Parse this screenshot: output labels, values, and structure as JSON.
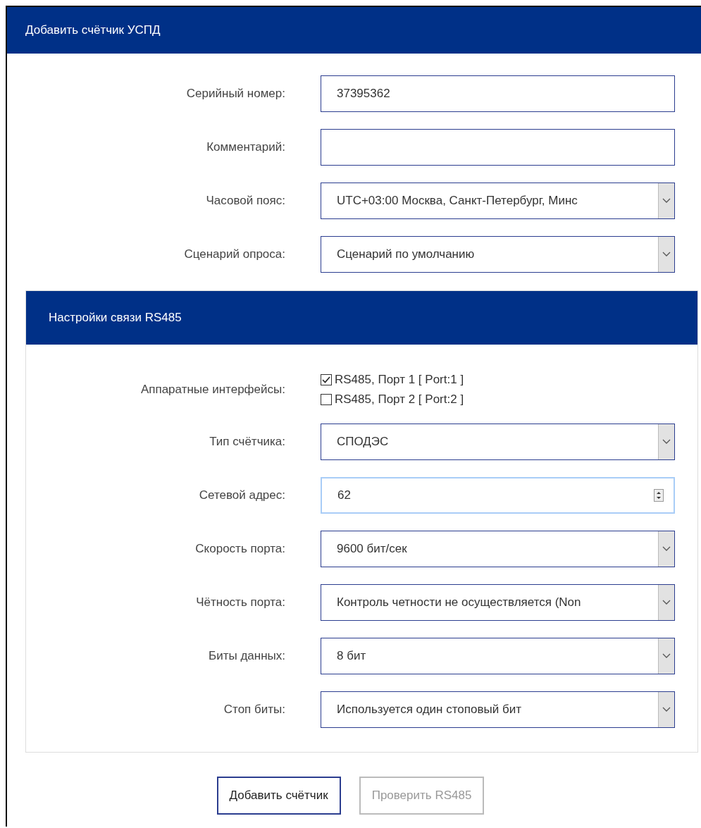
{
  "window": {
    "title": "Добавить счётчик УСПД"
  },
  "fields": [
    {
      "kind": "text",
      "label": "Серийный номер:",
      "value": "37395362"
    },
    {
      "kind": "text",
      "label": "Комментарий:"
    },
    {
      "kind": "select",
      "label": "Часовой пояс:",
      "value": "UTC+03:00 Москва, Санкт-Петербург, Минс"
    },
    {
      "kind": "select",
      "label": "Сценарий опроса:",
      "value": "Сценарий по умолчанию"
    }
  ],
  "rs485": {
    "title": "Настройки связи RS485",
    "interfaces": {
      "label": "Аппаратные интерфейсы:",
      "options": [
        {
          "label": "RS485, Порт 1 [ Port:1 ]",
          "checked": true
        },
        {
          "label": "RS485, Порт 2 [ Port:2 ]",
          "checked": false
        }
      ]
    },
    "fields": [
      {
        "kind": "select",
        "label": "Тип счётчика:",
        "value": "СПОДЭС"
      },
      {
        "kind": "number",
        "label": "Сетевой адрес:",
        "value": "62",
        "focused": true
      },
      {
        "kind": "select",
        "label": "Скорость порта:",
        "value": "9600 бит/сек"
      },
      {
        "kind": "select",
        "label": "Чётность порта:",
        "value": "Контроль четности не осуществляется (Non"
      },
      {
        "kind": "select",
        "label": "Биты данных:",
        "value": "8 бит"
      },
      {
        "kind": "select",
        "label": "Стоп биты:",
        "value": "Используется один стоповый бит"
      }
    ]
  },
  "buttons": [
    {
      "label": "Добавить счётчик",
      "disabled": false
    },
    {
      "label": "Проверить RS485",
      "disabled": true
    }
  ]
}
